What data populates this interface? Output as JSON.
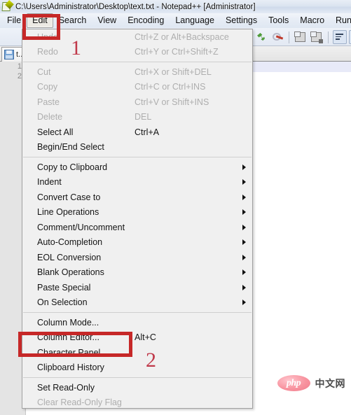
{
  "window": {
    "title": "C:\\Users\\Administrator\\Desktop\\text.txt - Notepad++ [Administrator]",
    "icon": "notepad-plus-plus-icon"
  },
  "menubar": {
    "items": [
      {
        "label": "File",
        "active": false
      },
      {
        "label": "Edit",
        "active": true
      },
      {
        "label": "Search",
        "active": false
      },
      {
        "label": "View",
        "active": false
      },
      {
        "label": "Encoding",
        "active": false
      },
      {
        "label": "Language",
        "active": false
      },
      {
        "label": "Settings",
        "active": false
      },
      {
        "label": "Tools",
        "active": false
      },
      {
        "label": "Macro",
        "active": false
      },
      {
        "label": "Run",
        "active": false
      }
    ]
  },
  "toolbar": {
    "icons": [
      "plugin-manager-icon",
      "macro-stop-icon",
      "window-duplicate-icon",
      "window-lock-icon",
      "word-wrap-icon",
      "show-all-characters-icon"
    ]
  },
  "tab": {
    "label": "t...",
    "icon": "save-file-icon"
  },
  "editor": {
    "line_numbers": [
      "1",
      "2"
    ]
  },
  "edit_menu": {
    "groups": [
      {
        "items": [
          {
            "label": "Undo",
            "accel": "Ctrl+Z or Alt+Backspace",
            "disabled": true,
            "submenu": false
          },
          {
            "label": "Redo",
            "accel": "Ctrl+Y or Ctrl+Shift+Z",
            "disabled": true,
            "submenu": false
          }
        ]
      },
      {
        "items": [
          {
            "label": "Cut",
            "accel": "Ctrl+X or Shift+DEL",
            "disabled": true,
            "submenu": false
          },
          {
            "label": "Copy",
            "accel": "Ctrl+C or Ctrl+INS",
            "disabled": true,
            "submenu": false
          },
          {
            "label": "Paste",
            "accel": "Ctrl+V or Shift+INS",
            "disabled": true,
            "submenu": false
          },
          {
            "label": "Delete",
            "accel": "DEL",
            "disabled": true,
            "submenu": false
          },
          {
            "label": "Select All",
            "accel": "Ctrl+A",
            "disabled": false,
            "submenu": false
          },
          {
            "label": "Begin/End Select",
            "accel": "",
            "disabled": false,
            "submenu": false
          }
        ]
      },
      {
        "items": [
          {
            "label": "Copy to Clipboard",
            "accel": "",
            "disabled": false,
            "submenu": true
          },
          {
            "label": "Indent",
            "accel": "",
            "disabled": false,
            "submenu": true
          },
          {
            "label": "Convert Case to",
            "accel": "",
            "disabled": false,
            "submenu": true
          },
          {
            "label": "Line Operations",
            "accel": "",
            "disabled": false,
            "submenu": true
          },
          {
            "label": "Comment/Uncomment",
            "accel": "",
            "disabled": false,
            "submenu": true
          },
          {
            "label": "Auto-Completion",
            "accel": "",
            "disabled": false,
            "submenu": true
          },
          {
            "label": "EOL Conversion",
            "accel": "",
            "disabled": false,
            "submenu": true
          },
          {
            "label": "Blank Operations",
            "accel": "",
            "disabled": false,
            "submenu": true
          },
          {
            "label": "Paste Special",
            "accel": "",
            "disabled": false,
            "submenu": true
          },
          {
            "label": "On Selection",
            "accel": "",
            "disabled": false,
            "submenu": true
          }
        ]
      },
      {
        "items": [
          {
            "label": "Column Mode...",
            "accel": "",
            "disabled": false,
            "submenu": false
          },
          {
            "label": "Column Editor...",
            "accel": "Alt+C",
            "disabled": false,
            "submenu": false
          },
          {
            "label": "Character Panel",
            "accel": "",
            "disabled": false,
            "submenu": false
          },
          {
            "label": "Clipboard History",
            "accel": "",
            "disabled": false,
            "submenu": false
          }
        ]
      },
      {
        "items": [
          {
            "label": "Set Read-Only",
            "accel": "",
            "disabled": false,
            "submenu": false
          },
          {
            "label": "Clear Read-Only Flag",
            "accel": "",
            "disabled": true,
            "submenu": false
          }
        ]
      }
    ]
  },
  "annotations": {
    "color": "#c62828",
    "number_color": "#c0394a",
    "steps": [
      {
        "number": "1",
        "target": "Edit"
      },
      {
        "number": "2",
        "target": "Character Panel"
      }
    ]
  },
  "watermark": {
    "logo_text": "php",
    "site_text": "中文网"
  }
}
